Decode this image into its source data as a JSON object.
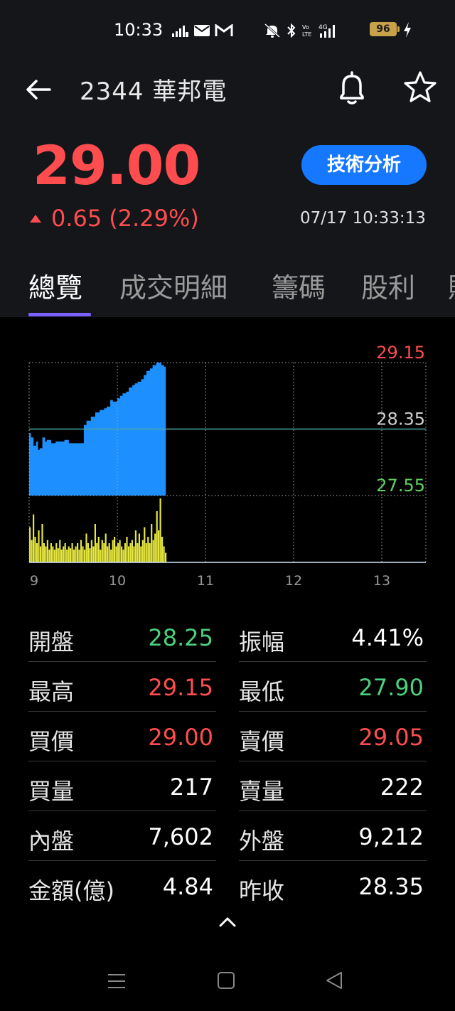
{
  "status_bar": {
    "time": "10:33",
    "battery": "96",
    "icons": [
      "signal-icon",
      "mail-icon",
      "gmail-icon",
      "mute-icon",
      "bluetooth-icon",
      "volte-icon",
      "4g-signal-icon",
      "battery-icon",
      "charging-icon"
    ]
  },
  "header": {
    "stock_title": "2344 華邦電",
    "back_icon": "arrow-left-icon",
    "bell_icon": "bell-icon",
    "star_icon": "star-icon"
  },
  "quote": {
    "price": "29.00",
    "change": "0.65",
    "change_pct": "(2.29%)",
    "timestamp": "07/17 10:33:13",
    "ta_button": "技術分析"
  },
  "tabs": [
    {
      "label": "總覽",
      "active": true
    },
    {
      "label": "成交明細",
      "active": false
    },
    {
      "label": "籌碼",
      "active": false
    },
    {
      "label": "股利",
      "active": false
    },
    {
      "label": "財",
      "active": false
    }
  ],
  "chart_data": {
    "type": "area",
    "x_ticks": [
      "9",
      "10",
      "11",
      "12",
      "13"
    ],
    "y_labels": {
      "high": "29.15",
      "ref": "28.35",
      "low": "27.55"
    },
    "ylim": [
      27.55,
      29.15
    ],
    "reference_price": 28.35,
    "session": {
      "start_hour": 9,
      "end_hour": 13.5
    },
    "price_series": {
      "x": [
        9.0,
        9.02,
        9.05,
        9.08,
        9.1,
        9.12,
        9.15,
        9.18,
        9.2,
        9.25,
        9.3,
        9.35,
        9.4,
        9.45,
        9.5,
        9.55,
        9.6,
        9.62,
        9.65,
        9.7,
        9.75,
        9.8,
        9.85,
        9.88,
        9.92,
        9.95,
        10.0,
        10.03,
        10.06,
        10.1,
        10.13,
        10.17,
        10.2,
        10.23,
        10.27,
        10.3,
        10.33,
        10.37,
        10.4,
        10.44,
        10.47,
        10.5,
        10.53,
        10.55
      ],
      "y": [
        28.3,
        28.25,
        28.15,
        28.2,
        28.1,
        28.12,
        28.25,
        28.2,
        28.22,
        28.18,
        28.2,
        28.2,
        28.22,
        28.18,
        28.18,
        28.18,
        28.18,
        28.4,
        28.45,
        28.5,
        28.55,
        28.58,
        28.6,
        28.62,
        28.7,
        28.68,
        28.72,
        28.75,
        28.78,
        28.8,
        28.85,
        28.88,
        28.9,
        28.92,
        28.95,
        29.0,
        29.05,
        29.08,
        29.12,
        29.15,
        29.15,
        29.12,
        29.1,
        29.05
      ]
    },
    "volume_series": {
      "x": [
        9.0,
        9.02,
        9.04,
        9.06,
        9.08,
        9.1,
        9.12,
        9.14,
        9.16,
        9.18,
        9.2,
        9.22,
        9.24,
        9.26,
        9.28,
        9.3,
        9.32,
        9.34,
        9.36,
        9.38,
        9.4,
        9.42,
        9.44,
        9.46,
        9.48,
        9.5,
        9.52,
        9.54,
        9.56,
        9.58,
        9.6,
        9.62,
        9.64,
        9.66,
        9.68,
        9.7,
        9.72,
        9.74,
        9.76,
        9.78,
        9.8,
        9.82,
        9.84,
        9.86,
        9.88,
        9.9,
        9.92,
        9.94,
        9.96,
        9.98,
        10.0,
        10.02,
        10.04,
        10.06,
        10.08,
        10.1,
        10.12,
        10.14,
        10.16,
        10.18,
        10.2,
        10.22,
        10.24,
        10.26,
        10.28,
        10.3,
        10.32,
        10.34,
        10.36,
        10.38,
        10.4,
        10.42,
        10.44,
        10.46,
        10.48,
        10.5,
        10.52,
        10.54
      ],
      "v": [
        0.55,
        0.35,
        0.75,
        0.4,
        0.3,
        0.5,
        0.25,
        0.6,
        0.3,
        0.25,
        0.35,
        0.2,
        0.3,
        0.25,
        0.2,
        0.3,
        0.22,
        0.35,
        0.2,
        0.25,
        0.3,
        0.2,
        0.25,
        0.22,
        0.3,
        0.2,
        0.25,
        0.3,
        0.2,
        0.35,
        0.25,
        0.2,
        0.45,
        0.3,
        0.22,
        0.35,
        0.25,
        0.6,
        0.3,
        0.4,
        0.2,
        0.35,
        0.3,
        0.45,
        0.25,
        0.3,
        0.2,
        0.35,
        0.4,
        0.25,
        0.3,
        0.35,
        0.25,
        0.2,
        0.3,
        0.4,
        0.25,
        0.3,
        0.35,
        0.25,
        0.5,
        0.3,
        0.45,
        0.25,
        0.35,
        0.55,
        0.3,
        0.4,
        0.3,
        0.6,
        0.35,
        0.45,
        0.8,
        0.5,
        1.0,
        0.4,
        0.25,
        0.15
      ]
    },
    "colors": {
      "price_fill": "#1e8fff",
      "volume_fill": "#e6e640",
      "high_label": "#ff4d4f",
      "ref_label": "#d0d0d0",
      "low_label": "#5fd35f",
      "ref_line": "#4aa8a8",
      "grid": "#aaaaaa"
    }
  },
  "stats": [
    {
      "left": {
        "label": "開盤",
        "value": "28.25",
        "color": "#4cd07d"
      },
      "right": {
        "label": "振幅",
        "value": "4.41%",
        "color": "#ffffff"
      }
    },
    {
      "left": {
        "label": "最高",
        "value": "29.15",
        "color": "#ff4d4f"
      },
      "right": {
        "label": "最低",
        "value": "27.90",
        "color": "#4cd07d"
      }
    },
    {
      "left": {
        "label": "買價",
        "value": "29.00",
        "color": "#ff4d4f"
      },
      "right": {
        "label": "賣價",
        "value": "29.05",
        "color": "#ff4d4f"
      }
    },
    {
      "left": {
        "label": "買量",
        "value": "217",
        "color": "#ffffff"
      },
      "right": {
        "label": "賣量",
        "value": "222",
        "color": "#ffffff"
      }
    },
    {
      "left": {
        "label": "內盤",
        "value": "7,602",
        "color": "#ffffff"
      },
      "right": {
        "label": "外盤",
        "value": "9,212",
        "color": "#ffffff"
      }
    },
    {
      "left": {
        "label": "金額(億)",
        "value": "4.84",
        "color": "#ffffff"
      },
      "right": {
        "label": "昨收",
        "value": "28.35",
        "color": "#ffffff"
      }
    }
  ],
  "bottom_nav": {
    "expand_icon": "chevron-up-icon",
    "menu_icon": "menu-icon",
    "home_icon": "home-square-icon",
    "back_icon": "back-triangle-icon"
  }
}
